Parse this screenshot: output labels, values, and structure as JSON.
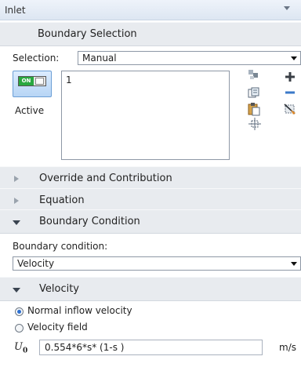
{
  "header": {
    "title": "Inlet"
  },
  "sections": {
    "boundary_selection": "Boundary Selection",
    "override": "Override and Contribution",
    "equation": "Equation",
    "boundary_condition": "Boundary Condition",
    "velocity": "Velocity"
  },
  "selection": {
    "label": "Selection:",
    "value": "Manual",
    "active_toggle_text": "ON",
    "active_label": "Active",
    "items": [
      "1"
    ]
  },
  "boundary_condition": {
    "label": "Boundary condition:",
    "value": "Velocity"
  },
  "velocity": {
    "options": [
      "Normal inflow velocity",
      "Velocity field"
    ],
    "selected": "Normal inflow velocity",
    "symbol": "U",
    "symbol_sub": "0",
    "expression": "0.554*6*s* (1-s )",
    "unit": "m/s"
  },
  "colors": {
    "accent": "#2c6fd1",
    "toggle_on": "#29a840",
    "remove_icon": "#3b79c9"
  },
  "icons": [
    "copy-selection-icon",
    "paste-icon",
    "clipboard-icon",
    "zoom-extents-icon",
    "add-icon",
    "remove-icon",
    "clear-selection-icon"
  ]
}
